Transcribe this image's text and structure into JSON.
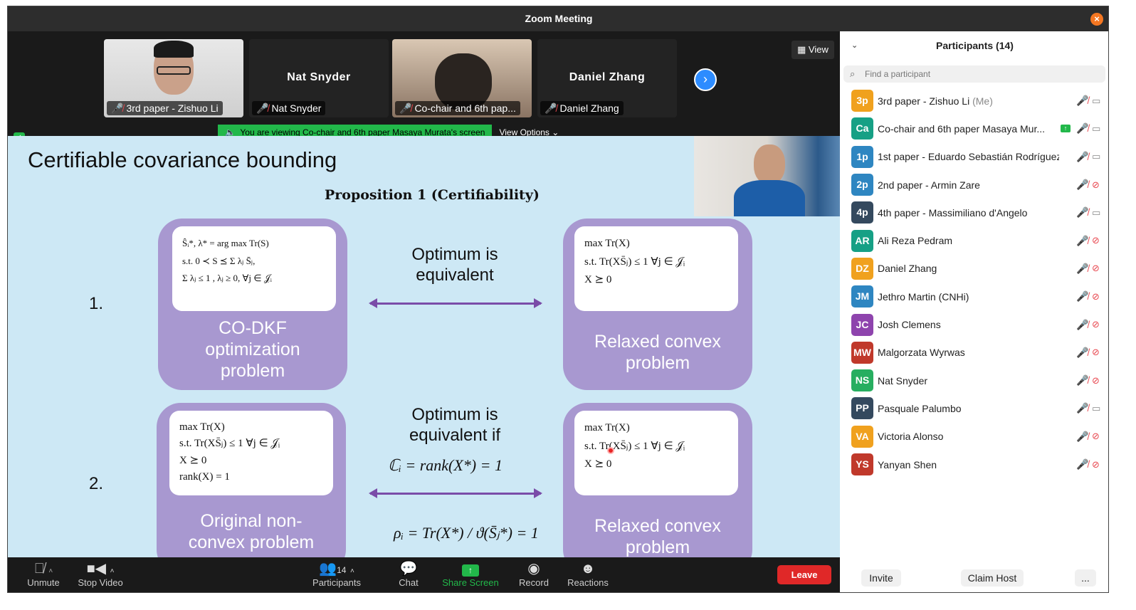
{
  "window": {
    "title": "Zoom Meeting"
  },
  "thumbnails": [
    {
      "label": "3rd paper - Zishuo Li",
      "name_display": ""
    },
    {
      "label": "Nat Snyder",
      "name_display": "Nat Snyder"
    },
    {
      "label": "Co-chair and 6th pap...",
      "name_display": ""
    },
    {
      "label": "Daniel Zhang",
      "name_display": "Daniel Zhang"
    }
  ],
  "view_button": {
    "label": "View"
  },
  "share_banner": {
    "text": "You are viewing Co-chair and 6th paper Masaya Murata's screen",
    "view_options": "View Options"
  },
  "slide": {
    "title": "Certifiable covariance bounding",
    "proposition": "Proposition 1 (Certifiability)",
    "row1": {
      "number": "1.",
      "left_caption": "CO-DKF optimization problem",
      "left_formula": [
        "Ŝᵢ*, λ* = arg max Tr(S)",
        "s.t. 0 ≺ S ⪯ Σ λⱼ S̄ⱼ,",
        "Σ λⱼ ≤ 1 , λⱼ ≥ 0, ∀j ∈ 𝒥ᵢ"
      ],
      "middle": "Optimum is equivalent",
      "right_caption": "Relaxed convex problem",
      "right_formula": [
        "max Tr(X)",
        "s.t. Tr(XS̄ⱼ) ≤ 1 ∀j ∈ 𝒥ᵢ",
        "X ⪰ 0"
      ]
    },
    "row2": {
      "number": "2.",
      "left_caption": "Original non-convex problem",
      "left_formula": [
        "max Tr(X)",
        "s.t. Tr(XS̄ⱼ) ≤ 1 ∀j ∈ 𝒥ᵢ",
        "X ⪰ 0",
        "rank(X) = 1"
      ],
      "middle": "Optimum is equivalent if",
      "condition1": "ℂᵢ = rank(X*) = 1",
      "condition2": "ρᵢ = Tr(X*) / ϑ(S̄ⱼ*) = 1",
      "right_caption": "Relaxed convex problem",
      "right_formula": [
        "max Tr(X)",
        "s.t. Tr(XS̄ⱼ) ≤ 1 ∀j ∈ 𝒥ᵢ",
        "X ⪰ 0"
      ]
    }
  },
  "toolbar": {
    "unmute": "Unmute",
    "stop_video": "Stop Video",
    "participants": "Participants",
    "participants_count": "14",
    "chat": "Chat",
    "share_screen": "Share Screen",
    "record": "Record",
    "reactions": "Reactions",
    "leave": "Leave"
  },
  "panel": {
    "title": "Participants (14)",
    "search_placeholder": "Find a participant",
    "invite": "Invite",
    "claim_host": "Claim Host",
    "more": "...",
    "participants": [
      {
        "initials": "3p",
        "name": "3rd paper - Zishuo Li",
        "suffix": "(Me)",
        "color": "#f0a11e",
        "video": "on",
        "sharing": false
      },
      {
        "initials": "Ca",
        "name": "Co-chair and 6th paper Masaya Mur...",
        "suffix": "",
        "color": "#16a085",
        "video": "on",
        "sharing": true
      },
      {
        "initials": "1p",
        "name": "1st paper - Eduardo Sebastián Rodríguez",
        "suffix": "",
        "color": "#2e86c1",
        "video": "on",
        "sharing": false
      },
      {
        "initials": "2p",
        "name": "2nd paper - Armin Zare",
        "suffix": "",
        "color": "#2e86c1",
        "video": "off",
        "sharing": false
      },
      {
        "initials": "4p",
        "name": "4th paper - Massimiliano d'Angelo",
        "suffix": "",
        "color": "#34495e",
        "video": "on",
        "sharing": false
      },
      {
        "initials": "AR",
        "name": "Ali Reza Pedram",
        "suffix": "",
        "color": "#16a085",
        "video": "off",
        "sharing": false
      },
      {
        "initials": "DZ",
        "name": "Daniel Zhang",
        "suffix": "",
        "color": "#f0a11e",
        "video": "off",
        "sharing": false
      },
      {
        "initials": "JM",
        "name": "Jethro Martin (CNHi)",
        "suffix": "",
        "color": "#2e86c1",
        "video": "off",
        "sharing": false
      },
      {
        "initials": "JC",
        "name": "Josh Clemens",
        "suffix": "",
        "color": "#8e44ad",
        "video": "off",
        "sharing": false
      },
      {
        "initials": "MW",
        "name": "Malgorzata Wyrwas",
        "suffix": "",
        "color": "#c0392b",
        "video": "off",
        "sharing": false
      },
      {
        "initials": "NS",
        "name": "Nat Snyder",
        "suffix": "",
        "color": "#27ae60",
        "video": "off",
        "sharing": false
      },
      {
        "initials": "PP",
        "name": "Pasquale Palumbo",
        "suffix": "",
        "color": "#34495e",
        "video": "on",
        "sharing": false
      },
      {
        "initials": "VA",
        "name": "Victoria Alonso",
        "suffix": "",
        "color": "#f0a11e",
        "video": "off",
        "sharing": false
      },
      {
        "initials": "YS",
        "name": "Yanyan Shen",
        "suffix": "",
        "color": "#c0392b",
        "video": "off",
        "sharing": false
      }
    ]
  }
}
